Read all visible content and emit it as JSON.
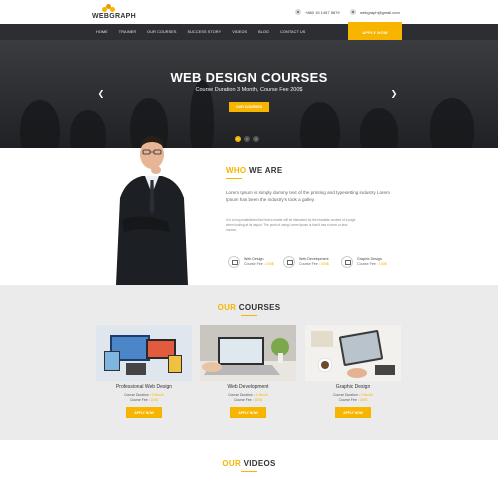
{
  "brand": {
    "name": "WEBGRAPH",
    "accent": "#f7b500",
    "nav_bg": "#2c2e33"
  },
  "header": {
    "phone": "+880 15 1457 5879",
    "email": "webgraph@gmail.com"
  },
  "nav": {
    "items": [
      "HOME",
      "TRAINER",
      "OUR COURSES",
      "SUCCESS STORY",
      "VIDEOS",
      "BLOG",
      "CONTACT US"
    ],
    "apply_label": "APPLY NOW"
  },
  "hero": {
    "title": "WEB DESIGN COURSES",
    "subtitle": "Course Duration 3 Month, Course Fee 200$",
    "button_label": "OUR COURSES",
    "slides": [
      "1",
      "2",
      "3"
    ],
    "prev_icon": "chevron-left-icon",
    "next_icon": "chevron-right-icon"
  },
  "who": {
    "title_accent": "WHO",
    "title_rest": " WE ARE",
    "paragraph1": "Lorem Ipsum is simply dummy text of the printing and typesetting industry Lorem Ipsum has been the industry's took a galley.",
    "paragraph2": "It is a long established fact that a reader will be distracted by the readable content of a page when looking at its layout. The point of using Lorem Ipsum is that it has a more-or-less normal.",
    "features": [
      {
        "name": "Web Design",
        "fee_label": "Course Fee :",
        "price": "200$"
      },
      {
        "name": "Web Development",
        "fee_label": "Course Fee :",
        "price": "300$"
      },
      {
        "name": "Graphic Design",
        "fee_label": "Course Fee :",
        "price": "150$"
      }
    ]
  },
  "courses": {
    "title_accent": "OUR",
    "title_rest": " COURSES",
    "cards": [
      {
        "title": "Professional Web Design",
        "duration_label": "Course Duration :",
        "duration": "3 Month",
        "fee_label": "Course Fee :",
        "fee": "200$",
        "button": "APPLY NOW"
      },
      {
        "title": "Web Development",
        "duration_label": "Course Duration :",
        "duration": "4 Month",
        "fee_label": "Course Fee :",
        "fee": "300$",
        "button": "APPLY NOW"
      },
      {
        "title": "Graphic Design",
        "duration_label": "Course Duration :",
        "duration": "3 Month",
        "fee_label": "Course Fee :",
        "fee": "150$",
        "button": "APPLY NOW"
      }
    ]
  },
  "videos": {
    "title_accent": "OUR",
    "title_rest": " VIDEOS"
  }
}
